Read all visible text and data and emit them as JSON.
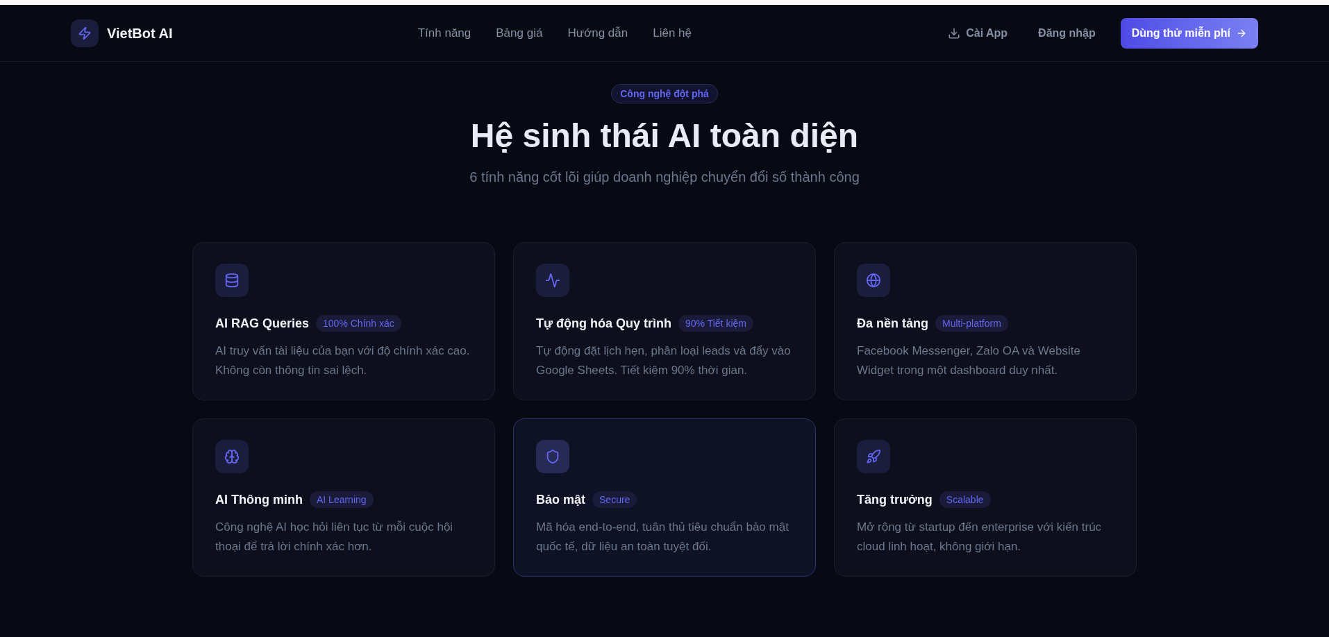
{
  "nav": {
    "brand": "VietBot AI",
    "links": [
      "Tính năng",
      "Bảng giá",
      "Hướng dẫn",
      "Liên hệ"
    ],
    "install": "Cài App",
    "login": "Đăng nhập",
    "cta": "Dùng thử miễn phí"
  },
  "hero": {
    "badge": "Công nghệ đột phá",
    "title": "Hệ sinh thái AI toàn diện",
    "subtitle": "6 tính năng cốt lõi giúp doanh nghiệp chuyển đổi số thành công"
  },
  "features": [
    {
      "title": "AI RAG Queries",
      "badge": "100% Chính xác",
      "description": "AI truy vấn tài liệu của bạn với độ chính xác cao. Không còn thông tin sai lệch.",
      "highlighted": false
    },
    {
      "title": "Tự động hóa Quy trình",
      "badge": "90% Tiết kiệm",
      "description": "Tự động đặt lịch hẹn, phân loại leads và đẩy vào Google Sheets. Tiết kiệm 90% thời gian.",
      "highlighted": false
    },
    {
      "title": "Đa nền tảng",
      "badge": "Multi-platform",
      "description": "Facebook Messenger, Zalo OA và Website Widget trong một dashboard duy nhất.",
      "highlighted": false
    },
    {
      "title": "AI Thông minh",
      "badge": "AI Learning",
      "description": "Công nghệ AI học hỏi liên tục từ mỗi cuộc hội thoại để trả lời chính xác hơn.",
      "highlighted": false
    },
    {
      "title": "Bảo mật",
      "badge": "Secure",
      "description": "Mã hóa end-to-end, tuân thủ tiêu chuẩn bảo mật quốc tế, dữ liệu an toàn tuyệt đối.",
      "highlighted": true
    },
    {
      "title": "Tăng trưởng",
      "badge": "Scalable",
      "description": "Mở rộng từ startup đến enterprise với kiến trúc cloud linh hoạt, không giới hạn.",
      "highlighted": false
    }
  ]
}
